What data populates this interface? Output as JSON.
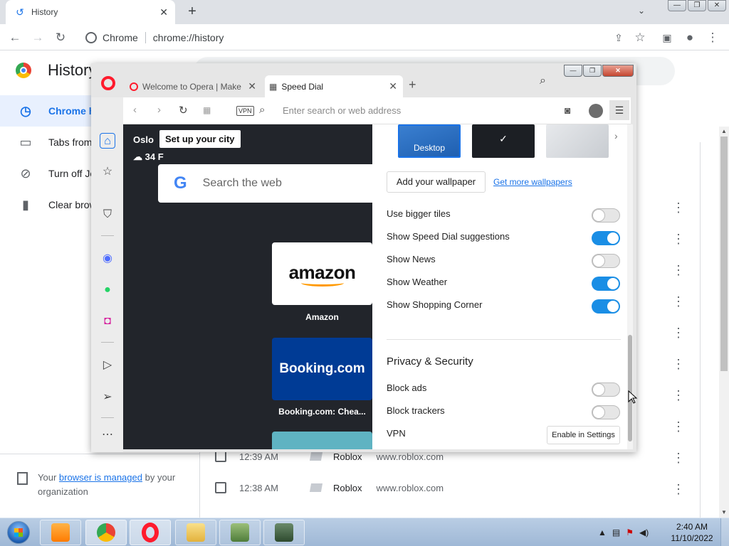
{
  "chrome": {
    "tab_title": "History",
    "omnibox_chip": "Chrome",
    "url": "chrome://history",
    "page_title": "History",
    "sidebar": [
      {
        "label": "Chrome history",
        "icon": "clock-icon"
      },
      {
        "label": "Tabs from other devices",
        "icon": "devices-icon"
      },
      {
        "label": "Turn off Journeys",
        "icon": "journeys-off-icon"
      },
      {
        "label": "Clear browsing data",
        "icon": "trash-icon"
      }
    ],
    "managed": {
      "prefix": "Your ",
      "link": "browser is managed",
      "suffix": " by your organization"
    },
    "rows": [
      {
        "time": "12:39 AM",
        "title": "Roblox",
        "domain": "www.roblox.com"
      },
      {
        "time": "12:38 AM",
        "title": "Roblox",
        "domain": "www.roblox.com"
      }
    ]
  },
  "opera": {
    "tabs": [
      {
        "title": "Welcome to Opera | Make"
      },
      {
        "title": "Speed Dial"
      }
    ],
    "vpn_badge": "VPN",
    "address_placeholder": "Enter search or web address",
    "weather": {
      "city": "Oslo",
      "temp": "34 F",
      "tip": "Set up your city"
    },
    "google_placeholder": "Search the web",
    "tiles": [
      {
        "name": "Amazon",
        "logo": "amazon"
      },
      {
        "name": "Booking.com: Chea...",
        "logo": "Booking.com"
      }
    ],
    "settings": {
      "wallpaper_desktop": "Desktop",
      "add_wallpaper": "Add your wallpaper",
      "more_wallpapers": "Get more wallpapers",
      "toggles": [
        {
          "label": "Use bigger tiles",
          "on": false
        },
        {
          "label": "Show Speed Dial suggestions",
          "on": true
        },
        {
          "label": "Show News",
          "on": false
        },
        {
          "label": "Show Weather",
          "on": true
        },
        {
          "label": "Show Shopping Corner",
          "on": true
        }
      ],
      "privacy_heading": "Privacy & Security",
      "privacy": [
        {
          "label": "Block ads",
          "on": false
        },
        {
          "label": "Block trackers",
          "on": false
        },
        {
          "label": "VPN",
          "button": "Enable in Settings"
        }
      ]
    }
  },
  "taskbar": {
    "clock_time": "2:40 AM",
    "clock_date": "11/10/2022"
  }
}
